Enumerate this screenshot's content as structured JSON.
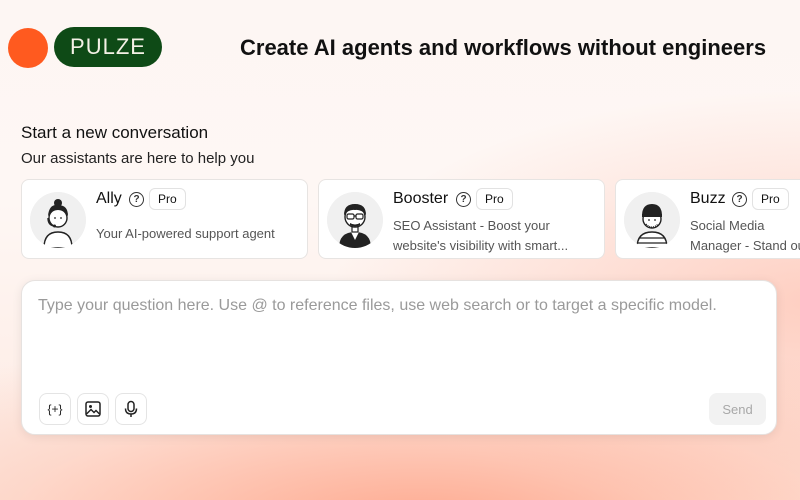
{
  "brand": {
    "name": "PULZE",
    "circle_color": "#ff5a1f",
    "pill_color": "#0e4a16"
  },
  "headline": "Create AI agents and workflows without engineers",
  "section": {
    "title": "Start a new conversation",
    "subtitle": "Our assistants are here to help you"
  },
  "assistants": [
    {
      "name": "Ally",
      "badge": "Pro",
      "description": "Your AI-powered support agent",
      "avatar_icon": "support-woman-avatar"
    },
    {
      "name": "Booster",
      "badge": "Pro",
      "description": "SEO Assistant - Boost your website's visibility with smart...",
      "avatar_icon": "glasses-man-avatar"
    },
    {
      "name": "Buzz",
      "badge": "Pro",
      "description": "Social Media Manager - Stand out with posts",
      "avatar_icon": "beanie-man-avatar"
    }
  ],
  "chat": {
    "placeholder": "Type your question here. Use @ to reference files, use web search or to target a specific model.",
    "variable_button": "{+}",
    "send_label": "Send"
  }
}
